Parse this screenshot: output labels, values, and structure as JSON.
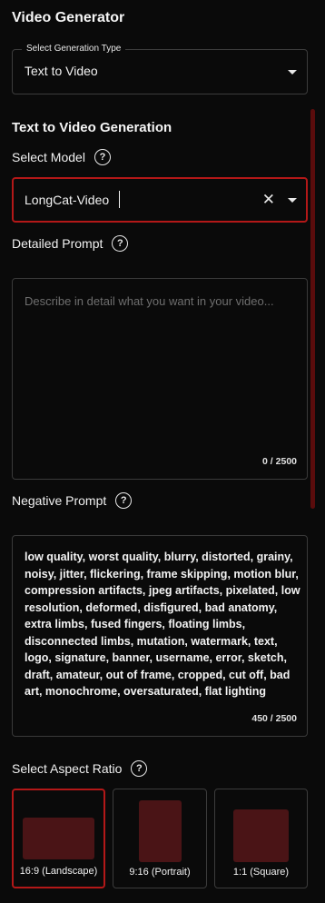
{
  "app": {
    "title": "Video Generator"
  },
  "generation_type": {
    "legend": "Select Generation Type",
    "value": "Text to Video"
  },
  "section": {
    "title": "Text to Video Generation"
  },
  "model": {
    "label": "Select Model",
    "value": "LongCat-Video"
  },
  "detailed_prompt": {
    "label": "Detailed Prompt",
    "placeholder": "Describe in detail what you want in your video...",
    "counter": "0 / 2500"
  },
  "negative_prompt": {
    "label": "Negative Prompt",
    "value": "low quality, worst quality, blurry, distorted, grainy, noisy, jitter, flickering, frame skipping, motion blur, compression artifacts, jpeg artifacts, pixelated, low resolution, deformed, disfigured, bad anatomy, extra limbs, fused fingers, floating limbs, disconnected limbs, mutation, watermark, text, logo, signature, banner, username, error, sketch, draft, amateur, out of frame, cropped, cut off, bad art, monochrome, oversaturated, flat lighting",
    "counter": "450 / 2500"
  },
  "aspect_ratio": {
    "label": "Select Aspect Ratio",
    "options": [
      {
        "label": "16:9 (Landscape)",
        "selected": true
      },
      {
        "label": "9:16 (Portrait)",
        "selected": false
      },
      {
        "label": "1:1 (Square)",
        "selected": false
      }
    ]
  },
  "icons": {
    "help": "question-circle-icon",
    "dropdown": "chevron-down-icon",
    "clear": "close-icon",
    "help_glyph": "?",
    "clear_glyph": "✕"
  },
  "colors": {
    "accent": "#b31818",
    "ratio_fill": "#4a1416",
    "scrollbar": "#5a0c0c",
    "background": "#0a0a0a"
  }
}
